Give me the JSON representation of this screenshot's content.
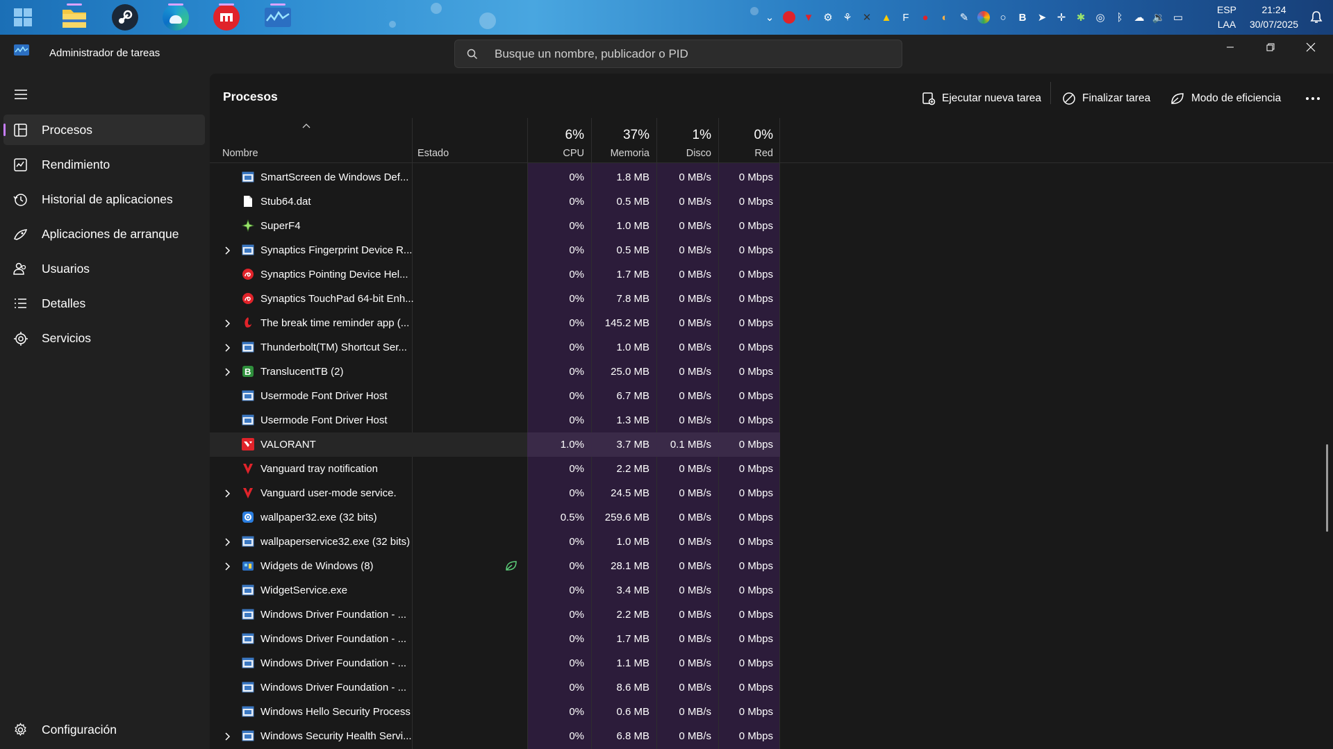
{
  "taskbar": {
    "apps": [
      {
        "name": "file-explorer",
        "color": "#f2c744"
      },
      {
        "name": "steam",
        "color": "#1b2838"
      },
      {
        "name": "edge",
        "color": "#1fa0d6"
      },
      {
        "name": "app-red",
        "color": "#e0232a"
      },
      {
        "name": "task-manager",
        "color": "#2b6fc2"
      }
    ],
    "language": "ESP",
    "layout": "LAA",
    "time": "21:24",
    "date": "30/07/2025"
  },
  "titlebar": {
    "app_title": "Administrador de tareas",
    "search_placeholder": "Busque un nombre, publicador o PID"
  },
  "sidebar": {
    "items": [
      {
        "label": "Procesos",
        "icon": "processes-icon",
        "active": true
      },
      {
        "label": "Rendimiento",
        "icon": "performance-icon"
      },
      {
        "label": "Historial de aplicaciones",
        "icon": "history-icon"
      },
      {
        "label": "Aplicaciones de arranque",
        "icon": "startup-icon"
      },
      {
        "label": "Usuarios",
        "icon": "users-icon"
      },
      {
        "label": "Detalles",
        "icon": "details-icon"
      },
      {
        "label": "Servicios",
        "icon": "services-icon"
      }
    ],
    "settings_label": "Configuración"
  },
  "main": {
    "title": "Procesos",
    "commands": {
      "run_task": "Ejecutar nueva tarea",
      "end_task": "Finalizar tarea",
      "efficiency": "Modo de eficiencia"
    },
    "columns": {
      "name": "Nombre",
      "status": "Estado",
      "cpu": {
        "pct": "6%",
        "label": "CPU"
      },
      "memory": {
        "pct": "37%",
        "label": "Memoria"
      },
      "disk": {
        "pct": "1%",
        "label": "Disco"
      },
      "network": {
        "pct": "0%",
        "label": "Red"
      }
    },
    "rows": [
      {
        "name": "SmartScreen de Windows Def...",
        "icon": "window-icon",
        "expand": false,
        "cpu": "0%",
        "mem": "1.8 MB",
        "disk": "0 MB/s",
        "net": "0 Mbps"
      },
      {
        "name": "Stub64.dat",
        "icon": "file-icon",
        "expand": false,
        "cpu": "0%",
        "mem": "0.5 MB",
        "disk": "0 MB/s",
        "net": "0 Mbps"
      },
      {
        "name": "SuperF4",
        "icon": "superf4-icon",
        "expand": false,
        "cpu": "0%",
        "mem": "1.0 MB",
        "disk": "0 MB/s",
        "net": "0 Mbps"
      },
      {
        "name": "Synaptics Fingerprint Device R...",
        "icon": "window-icon",
        "expand": true,
        "cpu": "0%",
        "mem": "0.5 MB",
        "disk": "0 MB/s",
        "net": "0 Mbps"
      },
      {
        "name": "Synaptics Pointing Device Hel...",
        "icon": "synaptics-icon",
        "expand": false,
        "cpu": "0%",
        "mem": "1.7 MB",
        "disk": "0 MB/s",
        "net": "0 Mbps"
      },
      {
        "name": "Synaptics TouchPad 64-bit Enh...",
        "icon": "synaptics-icon",
        "expand": false,
        "cpu": "0%",
        "mem": "7.8 MB",
        "disk": "0 MB/s",
        "net": "0 Mbps"
      },
      {
        "name": "The break time reminder app (...",
        "icon": "break-reminder-icon",
        "expand": true,
        "cpu": "0%",
        "mem": "145.2 MB",
        "disk": "0 MB/s",
        "net": "0 Mbps"
      },
      {
        "name": "Thunderbolt(TM) Shortcut Ser...",
        "icon": "window-icon",
        "expand": true,
        "cpu": "0%",
        "mem": "1.0 MB",
        "disk": "0 MB/s",
        "net": "0 Mbps"
      },
      {
        "name": "TranslucentTB (2)",
        "icon": "translucenttb-icon",
        "expand": true,
        "cpu": "0%",
        "mem": "25.0 MB",
        "disk": "0 MB/s",
        "net": "0 Mbps"
      },
      {
        "name": "Usermode Font Driver Host",
        "icon": "window-icon",
        "expand": false,
        "cpu": "0%",
        "mem": "6.7 MB",
        "disk": "0 MB/s",
        "net": "0 Mbps"
      },
      {
        "name": "Usermode Font Driver Host",
        "icon": "window-icon",
        "expand": false,
        "cpu": "0%",
        "mem": "1.3 MB",
        "disk": "0 MB/s",
        "net": "0 Mbps"
      },
      {
        "name": "VALORANT",
        "icon": "valorant-icon",
        "expand": false,
        "highlight": true,
        "cpu": "1.0%",
        "mem": "3.7 MB",
        "disk": "0.1 MB/s",
        "net": "0 Mbps"
      },
      {
        "name": "Vanguard tray notification",
        "icon": "vanguard-icon",
        "expand": false,
        "cpu": "0%",
        "mem": "2.2 MB",
        "disk": "0 MB/s",
        "net": "0 Mbps"
      },
      {
        "name": "Vanguard user-mode service.",
        "icon": "vanguard-icon",
        "expand": true,
        "cpu": "0%",
        "mem": "24.5 MB",
        "disk": "0 MB/s",
        "net": "0 Mbps"
      },
      {
        "name": "wallpaper32.exe (32 bits)",
        "icon": "wallpaper-icon",
        "expand": false,
        "cpu": "0.5%",
        "mem": "259.6 MB",
        "disk": "0 MB/s",
        "net": "0 Mbps"
      },
      {
        "name": "wallpaperservice32.exe (32 bits)",
        "icon": "window-icon",
        "expand": true,
        "cpu": "0%",
        "mem": "1.0 MB",
        "disk": "0 MB/s",
        "net": "0 Mbps"
      },
      {
        "name": "Widgets de Windows (8)",
        "icon": "widgets-icon",
        "expand": true,
        "status": "efficiency-mode-icon",
        "cpu": "0%",
        "mem": "28.1 MB",
        "disk": "0 MB/s",
        "net": "0 Mbps"
      },
      {
        "name": "WidgetService.exe",
        "icon": "window-icon",
        "expand": false,
        "cpu": "0%",
        "mem": "3.4 MB",
        "disk": "0 MB/s",
        "net": "0 Mbps"
      },
      {
        "name": "Windows Driver Foundation - ...",
        "icon": "window-icon",
        "expand": false,
        "cpu": "0%",
        "mem": "2.2 MB",
        "disk": "0 MB/s",
        "net": "0 Mbps"
      },
      {
        "name": "Windows Driver Foundation - ...",
        "icon": "window-icon",
        "expand": false,
        "cpu": "0%",
        "mem": "1.7 MB",
        "disk": "0 MB/s",
        "net": "0 Mbps"
      },
      {
        "name": "Windows Driver Foundation - ...",
        "icon": "window-icon",
        "expand": false,
        "cpu": "0%",
        "mem": "1.1 MB",
        "disk": "0 MB/s",
        "net": "0 Mbps"
      },
      {
        "name": "Windows Driver Foundation - ...",
        "icon": "window-icon",
        "expand": false,
        "cpu": "0%",
        "mem": "8.6 MB",
        "disk": "0 MB/s",
        "net": "0 Mbps"
      },
      {
        "name": "Windows Hello Security Process",
        "icon": "window-icon",
        "expand": false,
        "cpu": "0%",
        "mem": "0.6 MB",
        "disk": "0 MB/s",
        "net": "0 Mbps"
      },
      {
        "name": "Windows Security Health Servi...",
        "icon": "window-icon",
        "expand": true,
        "cpu": "0%",
        "mem": "6.8 MB",
        "disk": "0 MB/s",
        "net": "0 Mbps"
      }
    ]
  },
  "colors": {
    "accent": "#c77dff",
    "resource_bg": "#2c1c3a"
  }
}
